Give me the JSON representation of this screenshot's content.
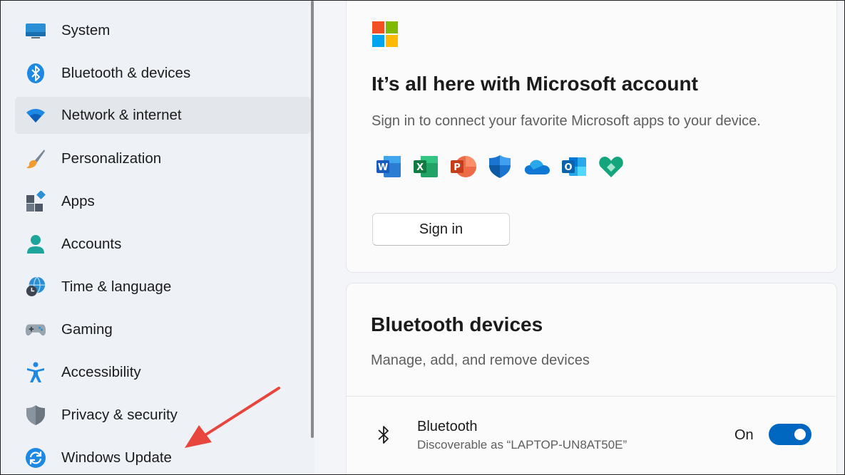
{
  "sidebar": {
    "items": [
      {
        "label": "System",
        "icon": "monitor-icon"
      },
      {
        "label": "Bluetooth & devices",
        "icon": "bluetooth-icon"
      },
      {
        "label": "Network & internet",
        "icon": "wifi-icon",
        "selected": true
      },
      {
        "label": "Personalization",
        "icon": "paintbrush-icon"
      },
      {
        "label": "Apps",
        "icon": "apps-icon"
      },
      {
        "label": "Accounts",
        "icon": "person-icon"
      },
      {
        "label": "Time & language",
        "icon": "globe-clock-icon"
      },
      {
        "label": "Gaming",
        "icon": "gamepad-icon"
      },
      {
        "label": "Accessibility",
        "icon": "accessibility-icon"
      },
      {
        "label": "Privacy & security",
        "icon": "shield-icon"
      },
      {
        "label": "Windows Update",
        "icon": "refresh-icon"
      }
    ]
  },
  "microsoft_card": {
    "title": "It’s all here with Microsoft account",
    "subtitle": "Sign in to connect your favorite Microsoft apps to your device.",
    "apps": [
      "word-icon",
      "excel-icon",
      "powerpoint-icon",
      "defender-icon",
      "onedrive-icon",
      "outlook-icon",
      "family-safety-icon"
    ],
    "signin_label": "Sign in"
  },
  "bluetooth_card": {
    "title": "Bluetooth devices",
    "subtitle": "Manage, add, and remove devices",
    "row_title": "Bluetooth",
    "row_subtitle": "Discoverable as “LAPTOP-UN8AT50E”",
    "state_label": "On",
    "toggle_on": true
  },
  "colors": {
    "accent": "#0067c0",
    "annotation_arrow": "#e8453c"
  }
}
